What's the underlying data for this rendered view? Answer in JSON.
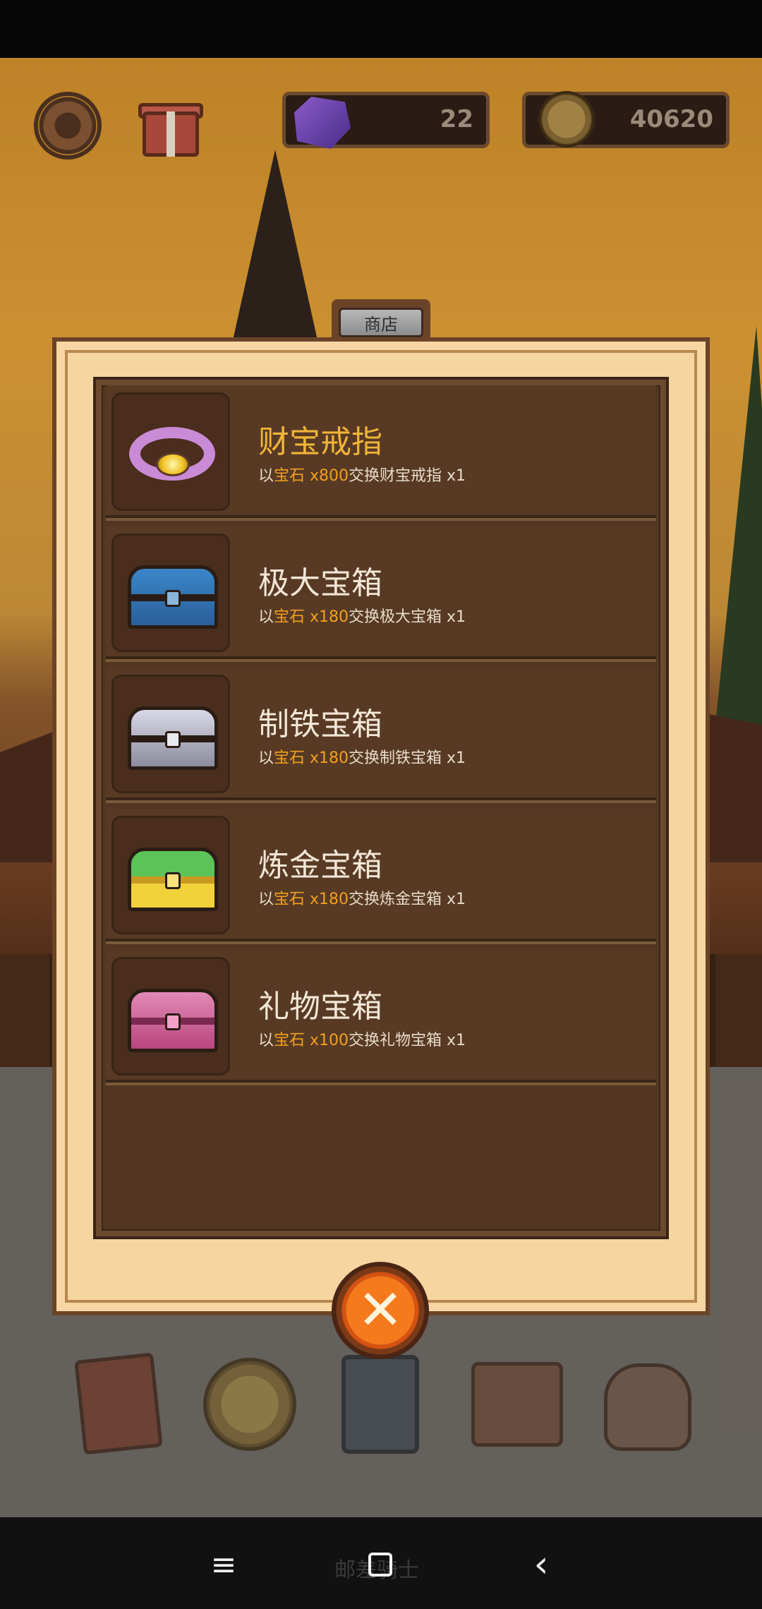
{
  "top_bar": {
    "settings_icon": "gear-icon",
    "gift_icon": "gift-icon",
    "gems": "22",
    "coins": "40620"
  },
  "shop": {
    "title": "商店",
    "items": [
      {
        "title": "财宝戒指",
        "desc_prefix": "以",
        "currency": "宝石",
        "price": "x800",
        "desc_suffix": "交换财宝戒指 x1",
        "icon": "treasure-ring-icon",
        "highlight": true
      },
      {
        "title": "极大宝箱",
        "desc_prefix": "以",
        "currency": "宝石",
        "price": "x180",
        "desc_suffix": "交换极大宝箱 x1",
        "icon": "blue-chest-icon",
        "highlight": false
      },
      {
        "title": "制铁宝箱",
        "desc_prefix": "以",
        "currency": "宝石",
        "price": "x180",
        "desc_suffix": "交换制铁宝箱 x1",
        "icon": "iron-chest-icon",
        "highlight": false
      },
      {
        "title": "炼金宝箱",
        "desc_prefix": "以",
        "currency": "宝石",
        "price": "x180",
        "desc_suffix": "交换炼金宝箱 x1",
        "icon": "alchemy-chest-icon",
        "highlight": false
      },
      {
        "title": "礼物宝箱",
        "desc_prefix": "以",
        "currency": "宝石",
        "price": "x100",
        "desc_suffix": "交换礼物宝箱 x1",
        "icon": "gift-chest-icon",
        "highlight": false
      }
    ]
  },
  "close_icon": "close-icon",
  "bottom_menu": {
    "items": [
      "book-icon",
      "coin-icon",
      "card-icon",
      "backpack-icon",
      "sack-icon"
    ],
    "label": "邮差骑士"
  },
  "nav": {
    "menu": "≡",
    "back": "‹"
  },
  "colors": {
    "gold_title": "#f0b43a",
    "price_highlight": "#f0a020",
    "panel_bg": "#f5d6a0",
    "list_bg": "#523622",
    "close_orange": "#f47a1c"
  }
}
